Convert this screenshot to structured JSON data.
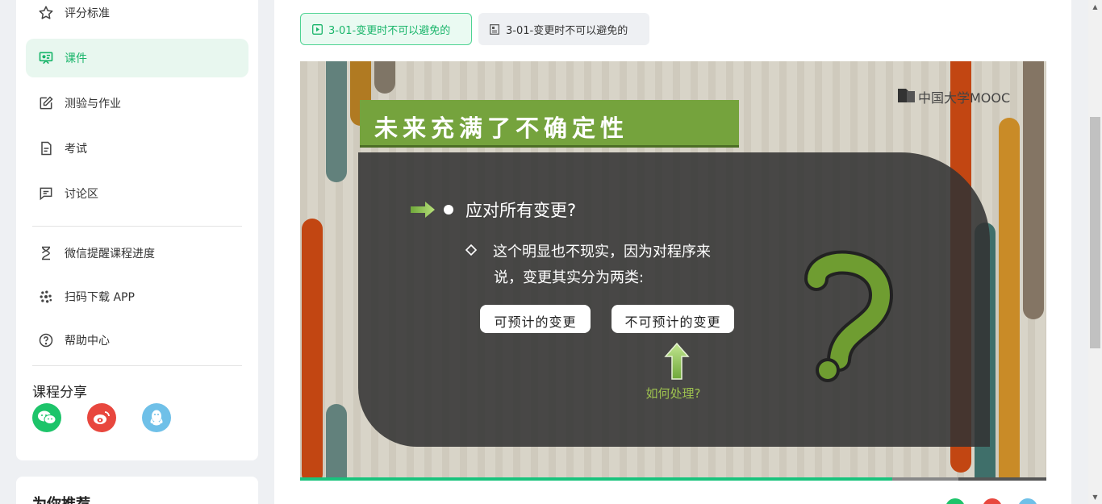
{
  "sidebar": {
    "items": [
      {
        "label": "评分标准",
        "icon": "star-icon"
      },
      {
        "label": "课件",
        "icon": "courseware-icon",
        "active": true
      },
      {
        "label": "测验与作业",
        "icon": "edit-icon"
      },
      {
        "label": "考试",
        "icon": "document-icon"
      },
      {
        "label": "讨论区",
        "icon": "comment-icon"
      }
    ],
    "tools": [
      {
        "label": "微信提醒课程进度",
        "icon": "hourglass-icon"
      },
      {
        "label": "扫码下载 APP",
        "icon": "app-icon"
      },
      {
        "label": "帮助中心",
        "icon": "help-icon"
      }
    ],
    "share_title": "课程分享",
    "share_icons": [
      "wechat-icon",
      "weibo-icon",
      "qq-icon"
    ],
    "recommend_title": "为你推荐"
  },
  "tabs": [
    {
      "label": "3-01-变更时不可以避免的",
      "icon": "play-icon",
      "active": true
    },
    {
      "label": "3-01-变更时不可以避免的",
      "icon": "doc-icon",
      "active": false
    }
  ],
  "slide": {
    "title": "未来充满了不确定性",
    "logo": "中国大学MOOC",
    "bullet": "应对所有变更?",
    "sub_line1": "这个明显也不现实，因为对程序来",
    "sub_line2": "说，变更其实分为两类:",
    "box1": "可预计的变更",
    "box2": "不可预计的变更",
    "hint": "如何处理?"
  },
  "player": {
    "progress_percent": 79.3,
    "buffered_percent": 88.2
  },
  "colors": {
    "accent": "#19b56a",
    "active_bg": "#e8f7ef",
    "progress": "#19c37d"
  }
}
